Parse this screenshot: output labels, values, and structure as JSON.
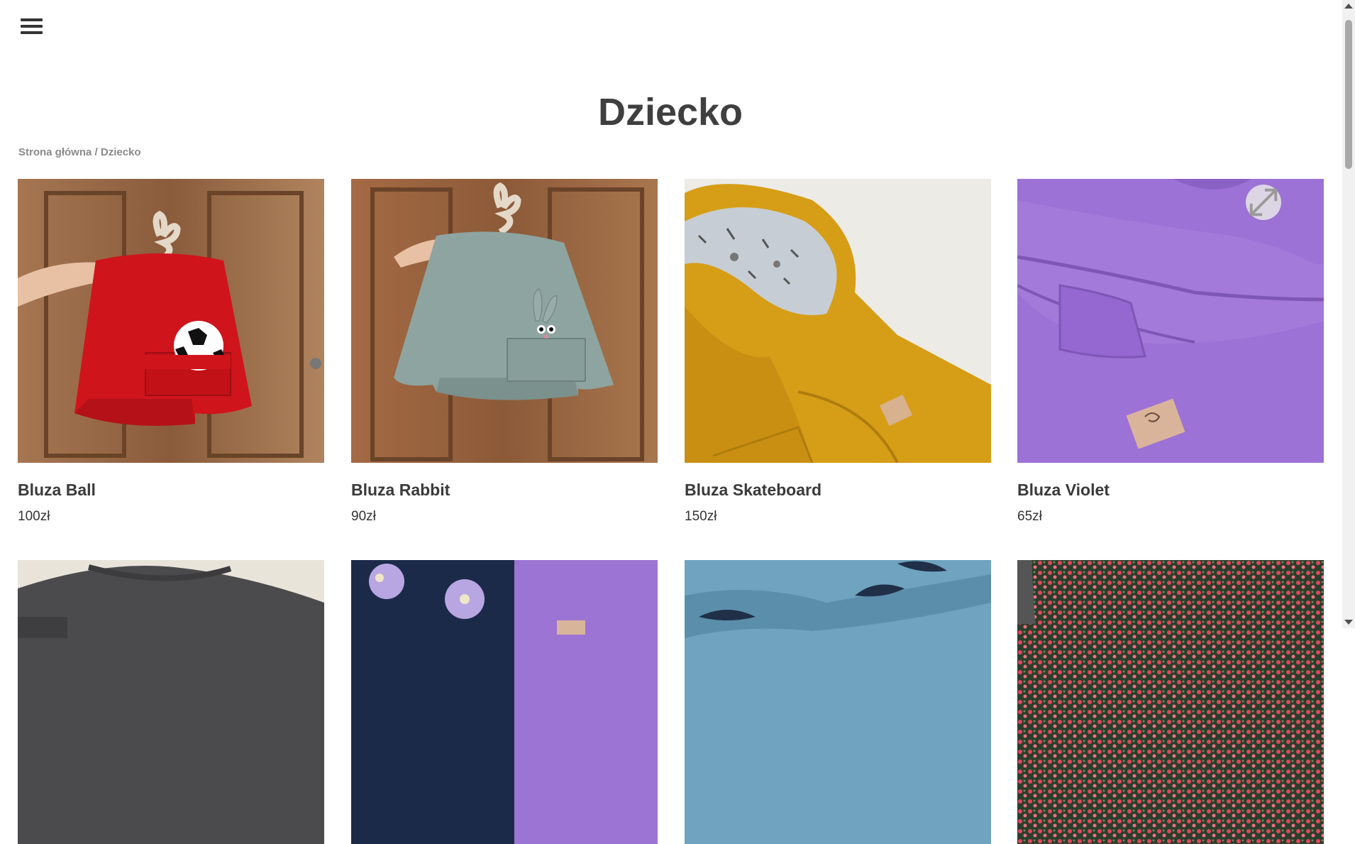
{
  "header": {
    "menu_icon": "hamburger-icon"
  },
  "page": {
    "title": "Dziecko"
  },
  "breadcrumb": {
    "home": "Strona główna",
    "separator": " / ",
    "current": "Dziecko"
  },
  "products": [
    {
      "name": "Bluza Ball",
      "price": "100zł",
      "color": "#c4161c"
    },
    {
      "name": "Bluza Rabbit",
      "price": "90zł",
      "color": "#8fa3a0"
    },
    {
      "name": "Bluza Skateboard",
      "price": "150zł",
      "color": "#d8a118"
    },
    {
      "name": "Bluza Violet",
      "price": "65zł",
      "color": "#9c72d6"
    }
  ],
  "products_row2": [
    {
      "color": "#4a4a4a"
    },
    {
      "color": "#1c2a4a"
    },
    {
      "color": "#6fa3bf"
    },
    {
      "color": "#2c3d2c"
    }
  ],
  "expand_icon": "expand-icon"
}
